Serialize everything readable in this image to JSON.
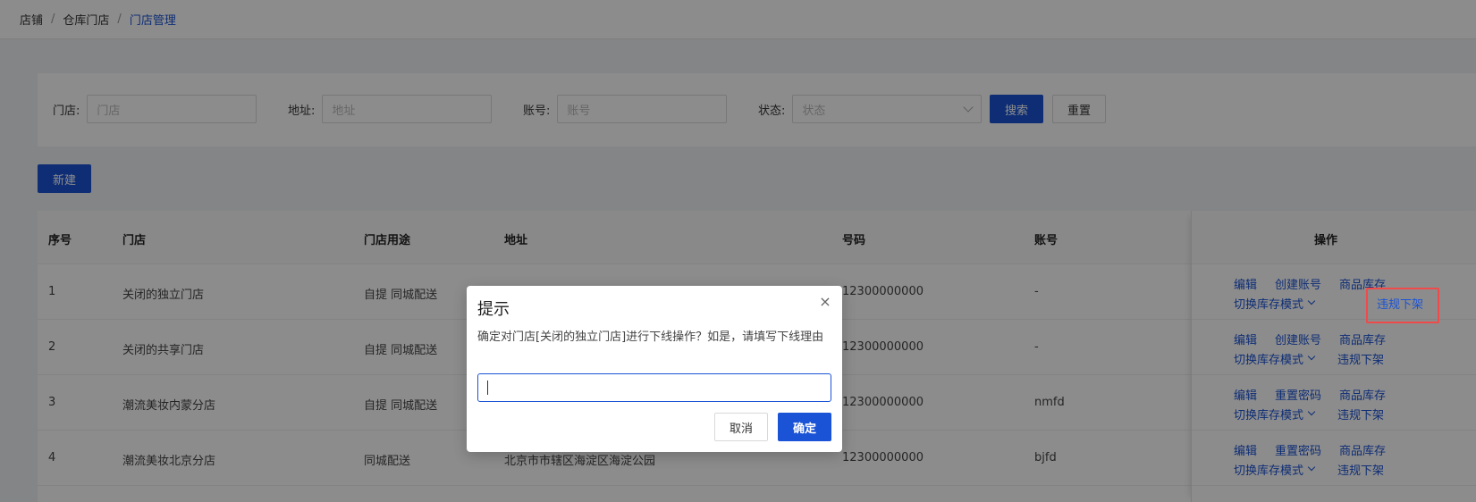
{
  "breadcrumb": {
    "items": [
      "店铺",
      "仓库门店",
      "门店管理"
    ],
    "separator": "/"
  },
  "search": {
    "store_label": "门店:",
    "store_placeholder": "门店",
    "address_label": "地址:",
    "address_placeholder": "地址",
    "account_label": "账号:",
    "account_placeholder": "账号",
    "status_label": "状态:",
    "status_placeholder": "状态",
    "search_button": "搜索",
    "reset_button": "重置"
  },
  "toolbar": {
    "new_button": "新建"
  },
  "table": {
    "columns": [
      "序号",
      "门店",
      "门店用途",
      "地址",
      "号码",
      "账号",
      "操作"
    ],
    "rows": [
      {
        "no": "1",
        "store": "关闭的独立门店",
        "usage": "自提 同城配送",
        "address": "",
        "phone": "12300000000",
        "account": "-",
        "op3": "商品库存"
      },
      {
        "no": "2",
        "store": "关闭的共享门店",
        "usage": "自提 同城配送",
        "address": "",
        "phone": "12300000000",
        "account": "-",
        "op3": "商品库存"
      },
      {
        "no": "3",
        "store": "潮流美妆内蒙分店",
        "usage": "自提 同城配送",
        "address": "",
        "phone": "12300000000",
        "account": "nmfd",
        "op3": "商品库存"
      },
      {
        "no": "4",
        "store": "潮流美妆北京分店",
        "usage": "同城配送",
        "address": "北京市市辖区海淀区海淀公园",
        "phone": "12300000000",
        "account": "bjfd",
        "op3": "商品库存"
      }
    ],
    "ops": {
      "edit": "编辑",
      "create_account": "创建账号",
      "reset_password": "重置密码",
      "stock": "商品库存",
      "switch_mode": "切换库存模式",
      "takedown": "违规下架"
    }
  },
  "dialog": {
    "title": "提示",
    "close": "×",
    "message": "确定对门店[关闭的独立门店]进行下线操作？如是，请填写下线理由",
    "input_value": "",
    "cancel": "取消",
    "ok": "确定"
  },
  "colors": {
    "primary": "#1a53d6",
    "highlight": "#f04a4a"
  }
}
